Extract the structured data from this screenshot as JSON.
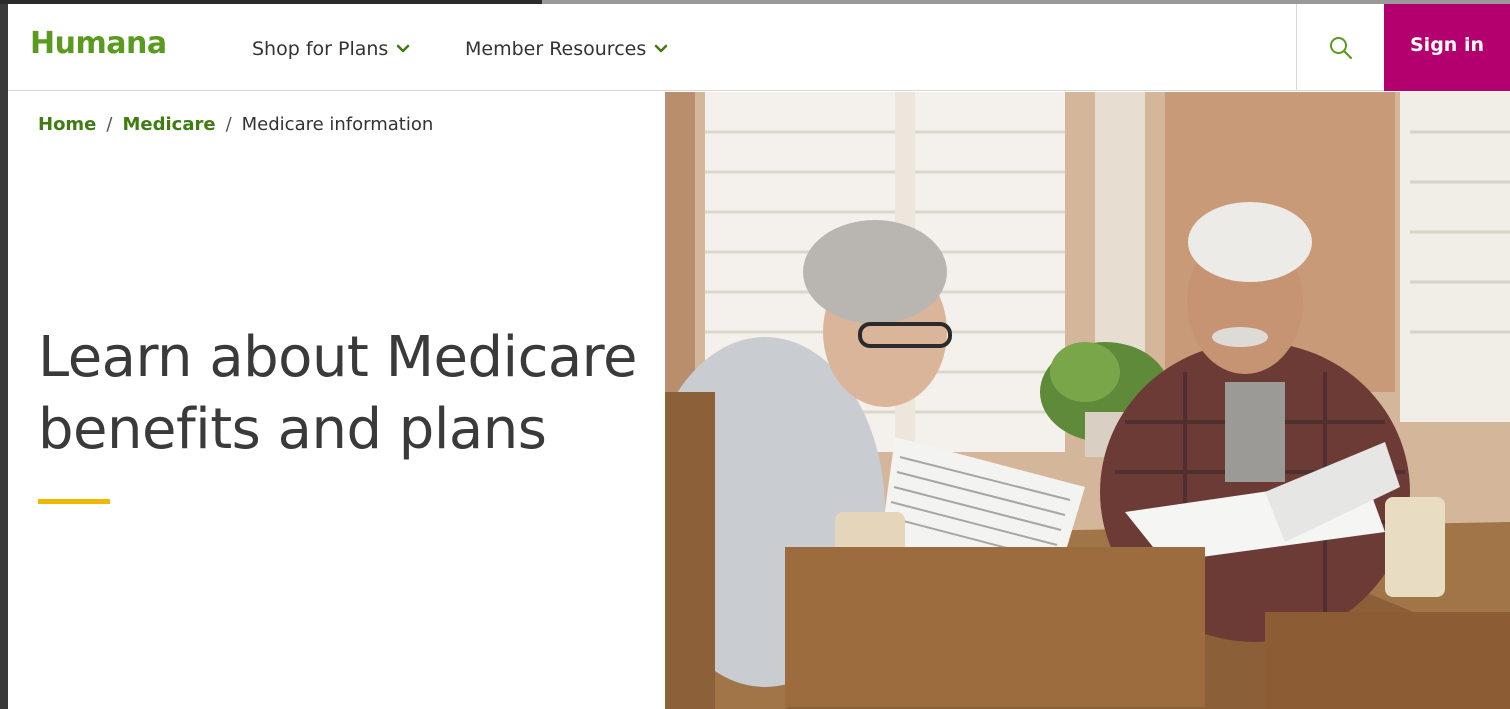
{
  "header": {
    "logo": "Humana",
    "nav": [
      {
        "label": "Shop for Plans"
      },
      {
        "label": "Member Resources"
      }
    ],
    "signin_label": "Sign in"
  },
  "breadcrumb": {
    "items": [
      "Home",
      "Medicare",
      "Medicare information"
    ]
  },
  "hero": {
    "title_line1": "Learn about Medicare",
    "title_line2": "benefits and plans"
  },
  "colors": {
    "brand_green": "#5a9a1f",
    "signin_magenta": "#b3006e",
    "accent_yellow": "#f2b705"
  },
  "icons": {
    "search": "search-icon",
    "chevron": "chevron-down-icon"
  }
}
